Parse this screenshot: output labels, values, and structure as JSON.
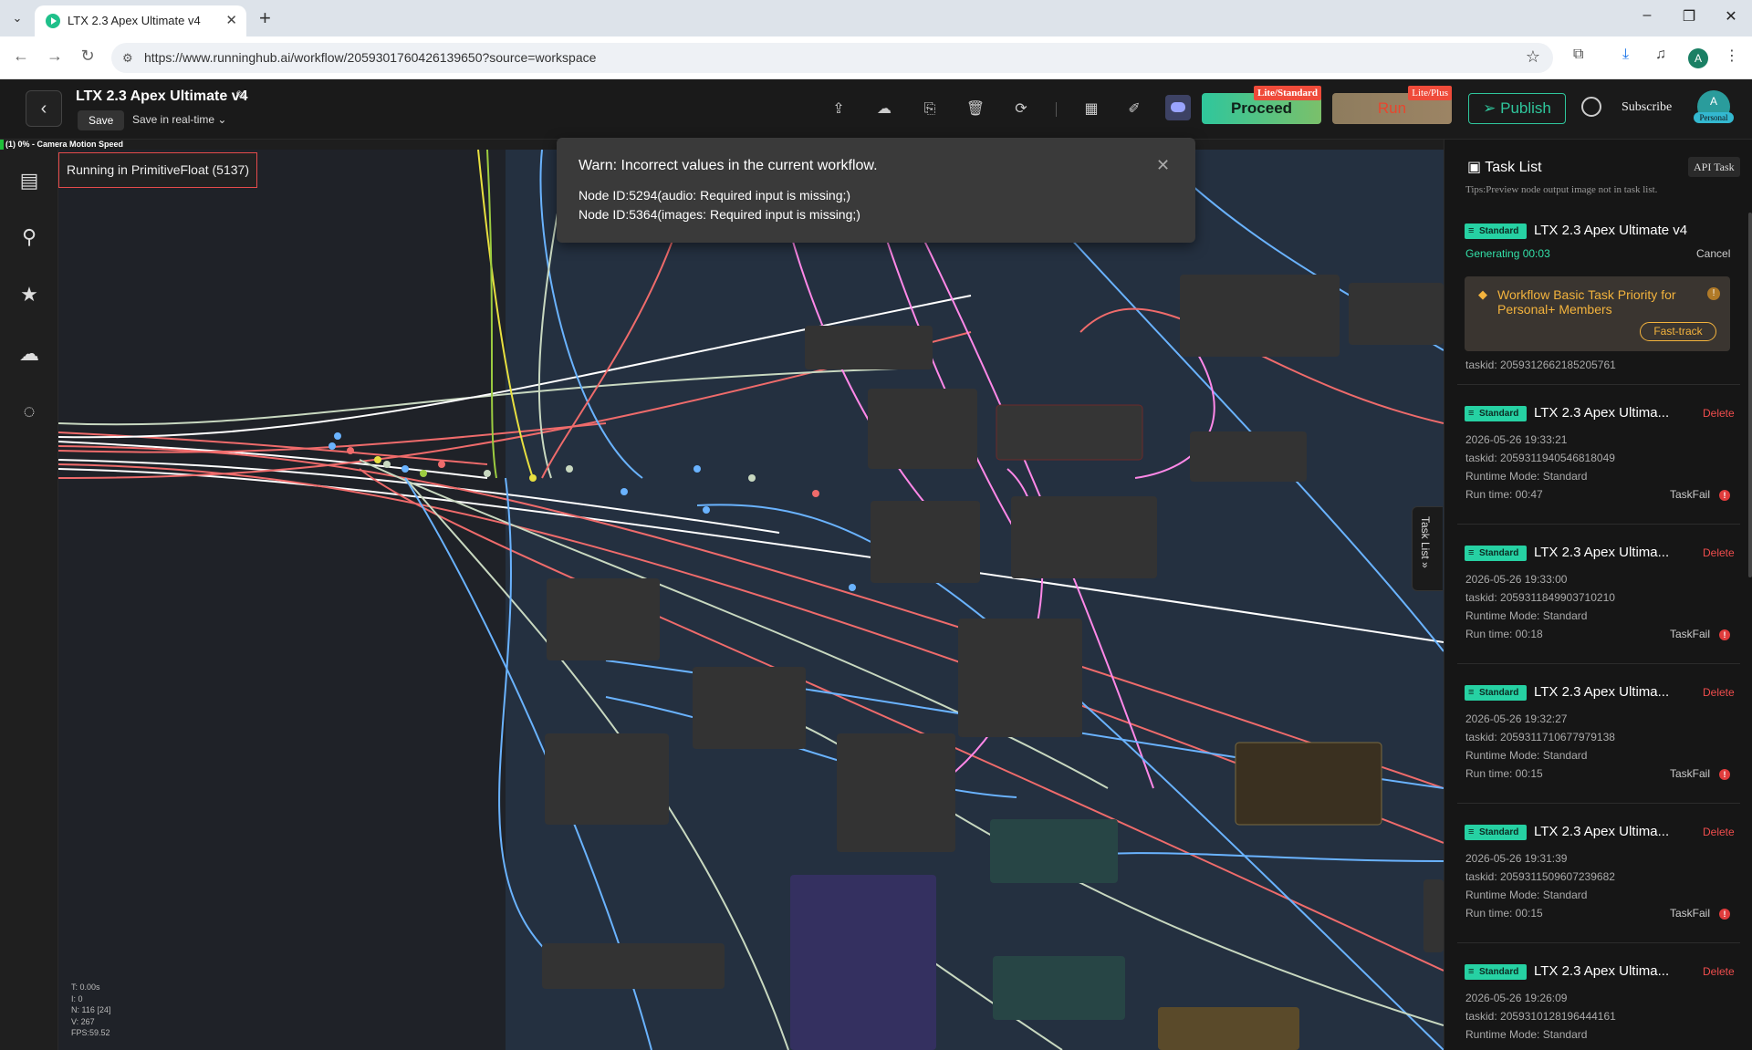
{
  "browser": {
    "tab_title": "LTX 2.3 Apex Ultimate v4",
    "url": "https://www.runninghub.ai/workflow/2059301760426139650?source=workspace"
  },
  "header": {
    "title": "LTX 2.3 Apex Ultimate v4",
    "save_label": "Save",
    "save_mode": "Save in real-time",
    "proceed_label": "Proceed",
    "proceed_badge": "Lite/Standard",
    "run_label": "Run",
    "run_badge": "Lite/Plus",
    "publish_label": "Publish",
    "subscribe_label": "Subscribe",
    "avatar_letter": "A",
    "avatar_badge": "Personal"
  },
  "status_strip": {
    "text": "(1) 0% - Camera Motion Speed",
    "progress": 0
  },
  "canvas": {
    "running_tag": "Running in PrimitiveFloat (5137)",
    "stats": [
      "T: 0.00s",
      "I: 0",
      "N: 116 [24]",
      "V: 267",
      "FPS:59.52"
    ]
  },
  "warning": {
    "title": "Warn: Incorrect values in the current workflow.",
    "lines": [
      "Node ID:5294(audio: Required input is missing;)",
      "Node ID:5364(images: Required input is missing;)"
    ]
  },
  "task_panel": {
    "title": "Task List",
    "api_task_label": "API Task",
    "tips": "Tips:Preview node output image not in task list.",
    "side_tab_label": "Task List",
    "current": {
      "badge": "Standard",
      "name": "LTX 2.3 Apex Ultimate v4",
      "status": "Generating 00:03",
      "cancel_label": "Cancel",
      "priority_text": "Workflow Basic Task Priority for Personal+ Members",
      "fasttrack_label": "Fast-track",
      "taskid": "taskid: 2059312662185205761"
    },
    "history": [
      {
        "badge": "Standard",
        "name": "LTX 2.3 Apex Ultima...",
        "delete": "Delete",
        "date": "2026-05-26 19:33:21",
        "taskid": "taskid: 2059311940546818049",
        "mode": "Runtime Mode: Standard",
        "runtime": "Run time: 00:47",
        "result": "TaskFail"
      },
      {
        "badge": "Standard",
        "name": "LTX 2.3 Apex Ultima...",
        "delete": "Delete",
        "date": "2026-05-26 19:33:00",
        "taskid": "taskid: 2059311849903710210",
        "mode": "Runtime Mode: Standard",
        "runtime": "Run time: 00:18",
        "result": "TaskFail"
      },
      {
        "badge": "Standard",
        "name": "LTX 2.3 Apex Ultima...",
        "delete": "Delete",
        "date": "2026-05-26 19:32:27",
        "taskid": "taskid: 2059311710677979138",
        "mode": "Runtime Mode: Standard",
        "runtime": "Run time: 00:15",
        "result": "TaskFail"
      },
      {
        "badge": "Standard",
        "name": "LTX 2.3 Apex Ultima...",
        "delete": "Delete",
        "date": "2026-05-26 19:31:39",
        "taskid": "taskid: 2059311509607239682",
        "mode": "Runtime Mode: Standard",
        "runtime": "Run time: 00:15",
        "result": "TaskFail"
      },
      {
        "badge": "Standard",
        "name": "LTX 2.3 Apex Ultima...",
        "delete": "Delete",
        "date": "2026-05-26 19:26:09",
        "taskid": "taskid: 2059310128196444161",
        "mode": "Runtime Mode: Standard",
        "runtime": "",
        "result": ""
      }
    ]
  },
  "colors": {
    "accent": "#26d1a3",
    "warning": "#f3b33d",
    "danger": "#ef4d4d"
  }
}
